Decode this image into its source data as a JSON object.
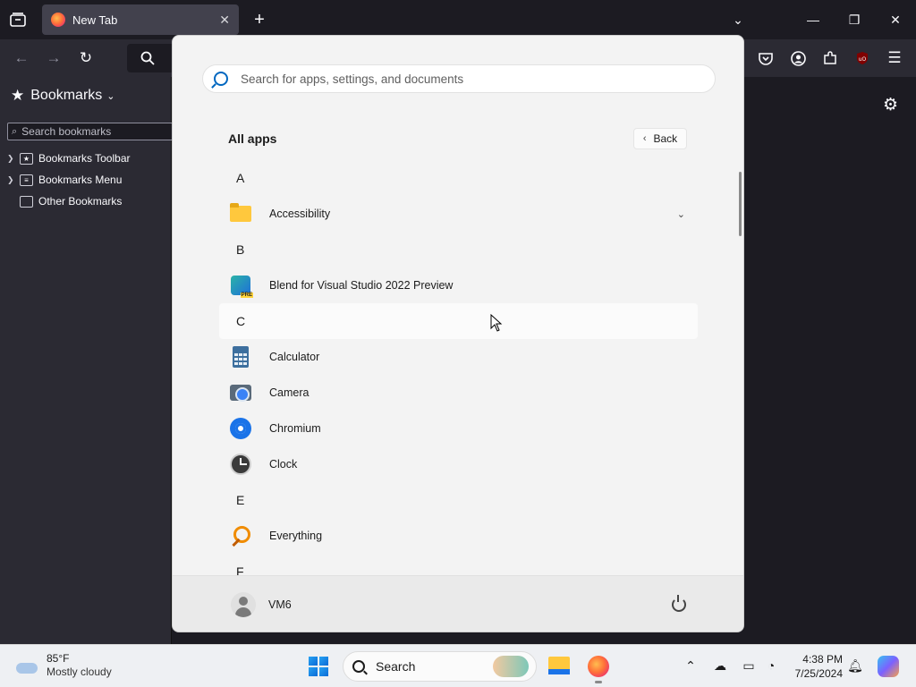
{
  "browser": {
    "tab_title": "New Tab",
    "tab_close_glyph": "✕",
    "new_tab_glyph": "+",
    "window_buttons": {
      "list": "⌄",
      "minimize": "—",
      "restore": "❐",
      "close": "✕"
    }
  },
  "sidebar": {
    "title": "Bookmarks",
    "search_placeholder": "Search bookmarks",
    "items": [
      {
        "label": "Bookmarks Toolbar",
        "icon": "star-folder-icon"
      },
      {
        "label": "Bookmarks Menu",
        "icon": "menu-folder-icon"
      },
      {
        "label": "Other Bookmarks",
        "icon": "folder-icon"
      }
    ]
  },
  "start_menu": {
    "search_placeholder": "Search for apps, settings, and documents",
    "all_apps_title": "All apps",
    "back_label": "Back",
    "sections": [
      {
        "letter": "A",
        "apps": [
          {
            "name": "Accessibility",
            "icon": "folder-icon",
            "expandable": true
          }
        ]
      },
      {
        "letter": "B",
        "apps": [
          {
            "name": "Blend for Visual Studio 2022 Preview",
            "icon": "blend-icon"
          }
        ]
      },
      {
        "letter": "C",
        "apps": [
          {
            "name": "Calculator",
            "icon": "calculator-icon"
          },
          {
            "name": "Camera",
            "icon": "camera-icon"
          },
          {
            "name": "Chromium",
            "icon": "chromium-icon"
          },
          {
            "name": "Clock",
            "icon": "clock-icon"
          }
        ]
      },
      {
        "letter": "E",
        "apps": [
          {
            "name": "Everything",
            "icon": "everything-icon"
          }
        ]
      },
      {
        "letter": "F",
        "apps": []
      }
    ],
    "user_name": "VM6"
  },
  "taskbar": {
    "weather_temp": "85°F",
    "weather_desc": "Mostly cloudy",
    "search_label": "Search",
    "time": "4:38 PM",
    "date": "7/25/2024"
  },
  "colors": {
    "accent": "#0067c0",
    "browser_bg": "#1c1b22",
    "toolbar_bg": "#2b2a33",
    "start_bg": "#f3f3f3"
  }
}
